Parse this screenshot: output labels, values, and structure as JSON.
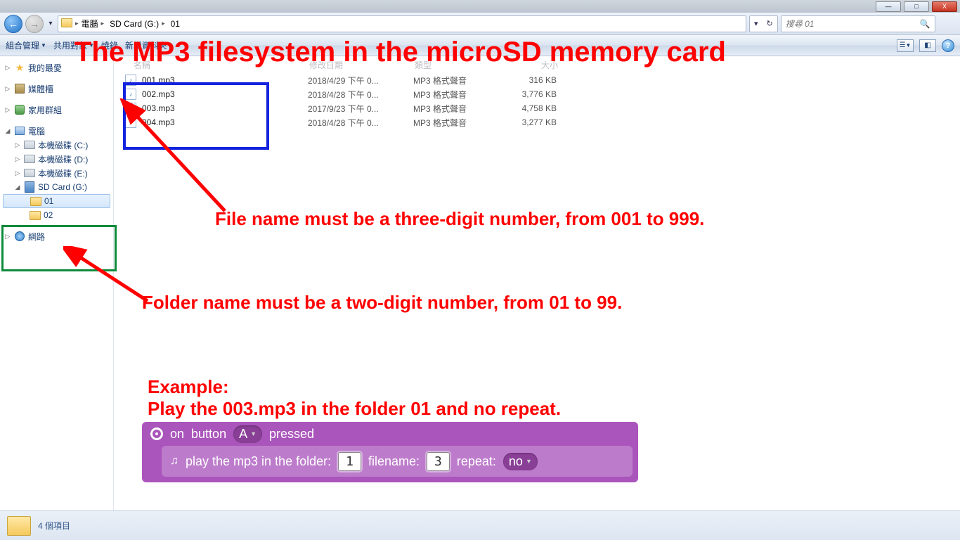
{
  "window_controls": {
    "min": "—",
    "max": "□",
    "close": "X"
  },
  "breadcrumb": {
    "segs": [
      "電腦",
      "SD Card (G:)",
      "01"
    ]
  },
  "search": {
    "placeholder": "搜尋 01"
  },
  "toolbar": {
    "organize": "組合管理",
    "other1": "共用對象",
    "other2": "燒錄",
    "other3": "新增資料夾"
  },
  "columns": {
    "name": "名稱",
    "date": "修改日期",
    "type": "類型",
    "size": "大小"
  },
  "sidebar": {
    "fav": "我的最愛",
    "lib": "媒體櫃",
    "homegroup": "家用群組",
    "computer": "電腦",
    "driveC": "本機磁碟 (C:)",
    "driveD": "本機磁碟 (D:)",
    "driveE": "本機磁碟 (E:)",
    "sdcard": "SD Card (G:)",
    "f01": "01",
    "f02": "02",
    "network": "網路"
  },
  "files": [
    {
      "name": "001.mp3",
      "date": "2018/4/29 下午 0...",
      "type": "MP3 格式聲音",
      "size": "316 KB"
    },
    {
      "name": "002.mp3",
      "date": "2018/4/28 下午 0...",
      "type": "MP3 格式聲音",
      "size": "3,776 KB"
    },
    {
      "name": "003.mp3",
      "date": "2017/9/23 下午 0...",
      "type": "MP3 格式聲音",
      "size": "4,758 KB"
    },
    {
      "name": "004.mp3",
      "date": "2018/4/28 下午 0...",
      "type": "MP3 格式聲音",
      "size": "3,277 KB"
    }
  ],
  "annotations": {
    "title": "The MP3 filesystem in the microSD memory card",
    "rule_file": "File name must be a three-digit number, from 001 to 999.",
    "rule_folder": "Folder name must be a two-digit number, from 01 to 99.",
    "example_h": "Example:",
    "example_t": "Play the 003.mp3 in the folder 01 and no repeat."
  },
  "block": {
    "on": "on",
    "button": "button",
    "A": "A",
    "pressed": "pressed",
    "play": "play the mp3 in the folder:",
    "filename": "filename:",
    "repeat": "repeat:",
    "val_folder": "1",
    "val_file": "3",
    "val_repeat": "no"
  },
  "status": {
    "count": "4 個項目"
  }
}
